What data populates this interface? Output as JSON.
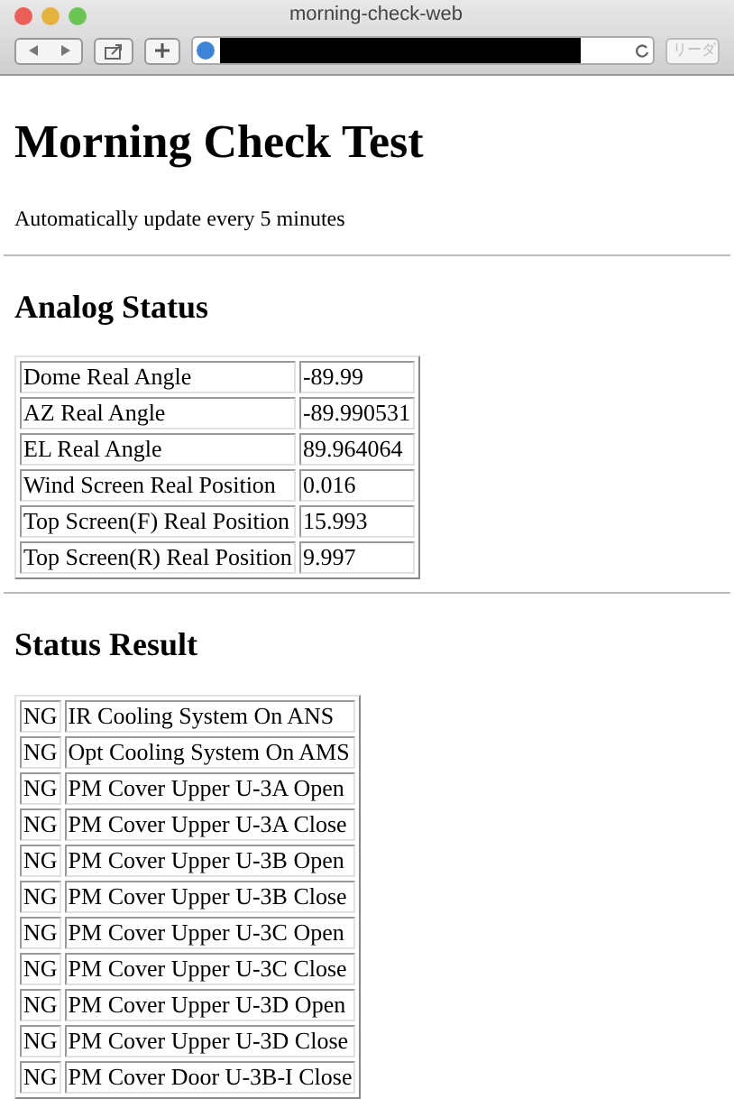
{
  "window": {
    "title": "morning-check-web"
  },
  "toolbar": {
    "reader_button": "リーダ"
  },
  "page": {
    "heading": "Morning Check Test",
    "note": "Automatically update every 5 minutes"
  },
  "analog_status": {
    "heading": "Analog Status",
    "rows": [
      {
        "name": "Dome Real Angle",
        "value": "-89.99"
      },
      {
        "name": "AZ Real Angle",
        "value": "-89.990531"
      },
      {
        "name": "EL Real Angle",
        "value": "89.964064"
      },
      {
        "name": "Wind Screen Real Position",
        "value": "0.016"
      },
      {
        "name": "Top Screen(F) Real Position",
        "value": "15.993"
      },
      {
        "name": "Top Screen(R) Real Position",
        "value": "9.997"
      }
    ]
  },
  "status_result": {
    "heading": "Status Result",
    "rows": [
      {
        "status": "NG",
        "item": "IR Cooling System On ANS"
      },
      {
        "status": "NG",
        "item": "Opt Cooling System On AMS"
      },
      {
        "status": "NG",
        "item": "PM Cover Upper U-3A Open"
      },
      {
        "status": "NG",
        "item": "PM Cover Upper U-3A Close"
      },
      {
        "status": "NG",
        "item": "PM Cover Upper U-3B Open"
      },
      {
        "status": "NG",
        "item": "PM Cover Upper U-3B Close"
      },
      {
        "status": "NG",
        "item": "PM Cover Upper U-3C Open"
      },
      {
        "status": "NG",
        "item": "PM Cover Upper U-3C Close"
      },
      {
        "status": "NG",
        "item": "PM Cover Upper U-3D Open"
      },
      {
        "status": "NG",
        "item": "PM Cover Upper U-3D Close"
      },
      {
        "status": "NG",
        "item": "PM Cover Door U-3B-I Close"
      }
    ]
  }
}
